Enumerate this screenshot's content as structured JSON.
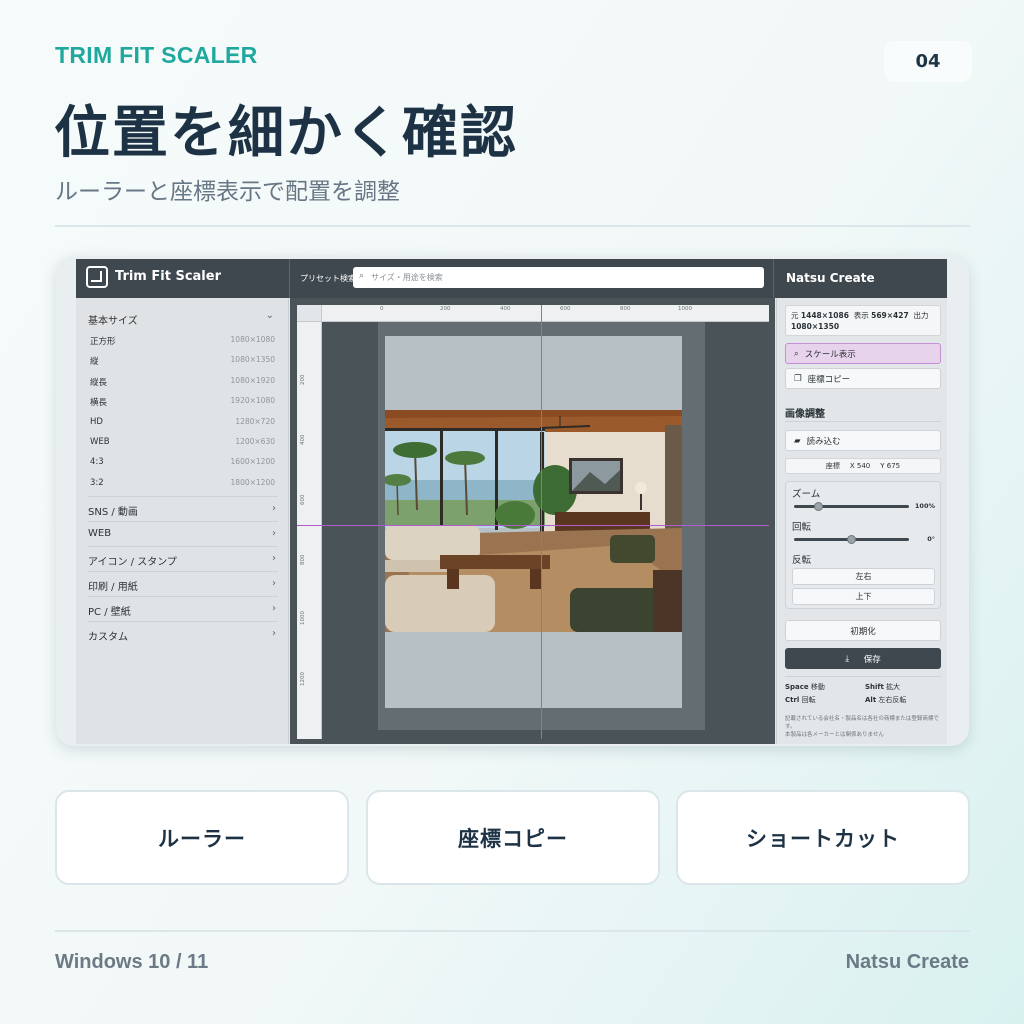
{
  "header": {
    "brand": "TRIM FIT SCALER",
    "page_number": "04",
    "title": "位置を細かく確認",
    "subtitle": "ルーラーと座標表示で配置を調整"
  },
  "app": {
    "title": "Trim Fit Scaler",
    "preset_search_label": "プリセット検索",
    "search_placeholder": "サイズ・用途を検索",
    "org_name": "Natsu Create",
    "sidebar": {
      "basic_group": "基本サイズ",
      "sizes": [
        {
          "name": "正方形",
          "dim": "1080×1080"
        },
        {
          "name": "縦",
          "dim": "1080×1350"
        },
        {
          "name": "縦長",
          "dim": "1080×1920"
        },
        {
          "name": "横長",
          "dim": "1920×1080"
        },
        {
          "name": "HD",
          "dim": "1280×720"
        },
        {
          "name": "WEB",
          "dim": "1200×630"
        },
        {
          "name": "4:3",
          "dim": "1600×1200"
        },
        {
          "name": "3:2",
          "dim": "1800×1200"
        }
      ],
      "categories": [
        "SNS / 動画",
        "WEB",
        "アイコン / スタンプ",
        "印刷 / 用紙",
        "PC / 壁紙",
        "カスタム"
      ]
    },
    "rulers": {
      "h_ticks": [
        "0",
        "200",
        "400",
        "600",
        "800",
        "1000"
      ],
      "v_ticks": [
        "200",
        "400",
        "600",
        "800",
        "1000",
        "1200"
      ]
    },
    "right_panel": {
      "info_original_label": "元",
      "info_original": "1448×1086",
      "info_display_label": "表示",
      "info_display": "569×427",
      "info_output_label": "出力",
      "info_output": "1080×1350",
      "scale_view_button": "スケール表示",
      "copy_coords_button": "座標コピー",
      "image_adjust_title": "画像調整",
      "load_button": "読み込む",
      "coord_label": "座標",
      "coord_x": "X 540",
      "coord_y": "Y 675",
      "zoom_label": "ズーム",
      "zoom_value": "100%",
      "zoom_level": 0.22,
      "rotate_label": "回転",
      "rotate_value": "0°",
      "rotate_level": 0.5,
      "flip_label": "反転",
      "flip_lr": "左右",
      "flip_ud": "上下",
      "reset_button": "初期化",
      "save_button": "保存",
      "shortcuts": [
        {
          "key": "Space",
          "action": "移動"
        },
        {
          "key": "Shift",
          "action": "拡大"
        },
        {
          "key": "Ctrl",
          "action": "回転"
        },
        {
          "key": "Alt",
          "action": "左右反転"
        }
      ],
      "disclaimer_1": "記載されている会社名・製品名は各社の商標または登録商標です。",
      "disclaimer_2": "本製品は各メーカーとは関係ありません"
    }
  },
  "features": [
    "ルーラー",
    "座標コピー",
    "ショートカット"
  ],
  "footer": {
    "os": "Windows 10 / 11",
    "company": "Natsu Create"
  },
  "colors": {
    "accent": "#1fa99e",
    "heading": "#1d3345",
    "guide": "#b05bd0",
    "app_dark": "#3f484e"
  }
}
